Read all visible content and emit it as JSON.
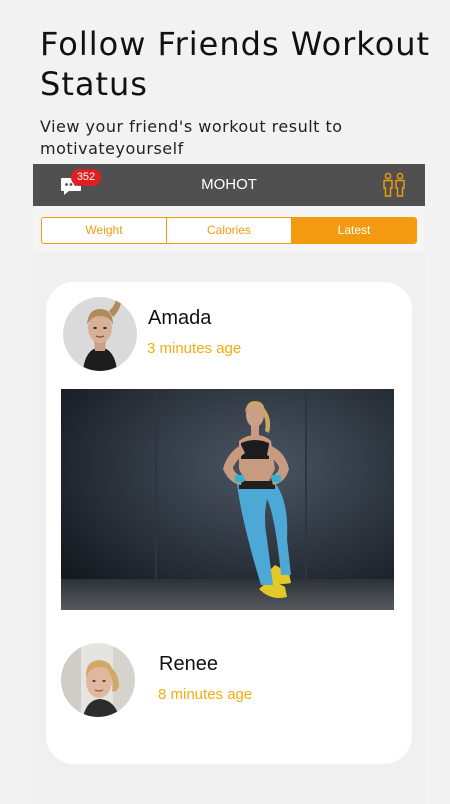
{
  "promo": {
    "title": "Follow Friends Workout Status",
    "subtitle": "View your friend's workout result to motivateyourself"
  },
  "appbar": {
    "title": "MOHOT",
    "message_badge": "352",
    "chat_icon": "chat-bubble-icon",
    "friends_icon": "friends-icon"
  },
  "tabs": [
    "Weight",
    "Calories",
    "Latest"
  ],
  "active_tab": "Latest",
  "posts": [
    {
      "name": "Amada",
      "time": "3 minutes age"
    },
    {
      "name": "Renee",
      "time": "8 minutes age"
    }
  ],
  "colors": {
    "accent": "#f49a10",
    "time": "#f4ad10",
    "appbar": "#505050",
    "badge": "#e02020"
  }
}
